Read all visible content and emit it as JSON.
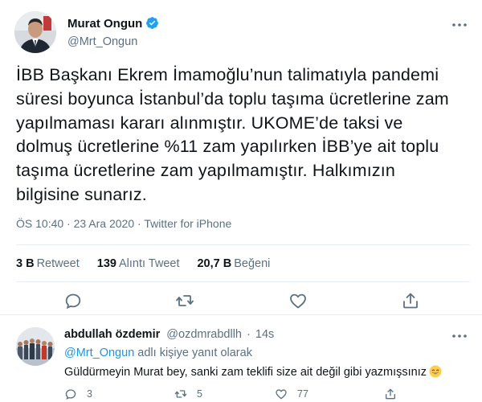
{
  "tweet": {
    "author_name": "Murat Ongun",
    "author_handle": "@Mrt_Ongun",
    "text": "İBB Başkanı Ekrem İmamoğlu’nun talimatıyla pandemi\nsüresi boyunca İstanbul’da toplu taşıma ücretlerine zam\nyapılmaması kararı alınmıştır. UKOME’de taksi ve\ndolmuş ücretlerine %11 zam yapılırken İBB’ye ait toplu\ntaşıma ücretlerine zam yapılmamıştır. Halkımızın\nbilgisine sunarız.",
    "time": "ÖS 10:40",
    "separator": "·",
    "date": "23 Ara 2020",
    "source": "Twitter for iPhone",
    "stats": {
      "retweets_count": "3 B",
      "retweets_label": "Retweet",
      "quotes_count": "139",
      "quotes_label": "Alıntı Tweet",
      "likes_count": "20,7 B",
      "likes_label": "Beğeni"
    },
    "icons": {
      "verified": "verified-badge-icon",
      "more": "more-dots-icon",
      "reply": "reply-icon",
      "retweet": "retweet-icon",
      "like": "heart-icon",
      "share": "share-icon"
    }
  },
  "reply": {
    "author_name": "abdullah özdemir",
    "author_handle": "@ozdmrabdllh",
    "separator": "·",
    "time": "14s",
    "replying_to_mention": "@Mrt_Ongun",
    "replying_to_suffix": "adlı kişiye yanıt olarak",
    "text": "Güldürmeyin Murat bey, sanki zam teklifi size ait değil gibi yazmışsınız",
    "emoji": "grinning-face-emoji",
    "reply_count": "3",
    "retweet_count": "5",
    "like_count": "77"
  },
  "colors": {
    "text_primary": "#0f1419",
    "text_secondary": "#5b7083",
    "accent": "#1b95e0",
    "verified": "#1da1f2",
    "divider": "#e6ecf0"
  }
}
